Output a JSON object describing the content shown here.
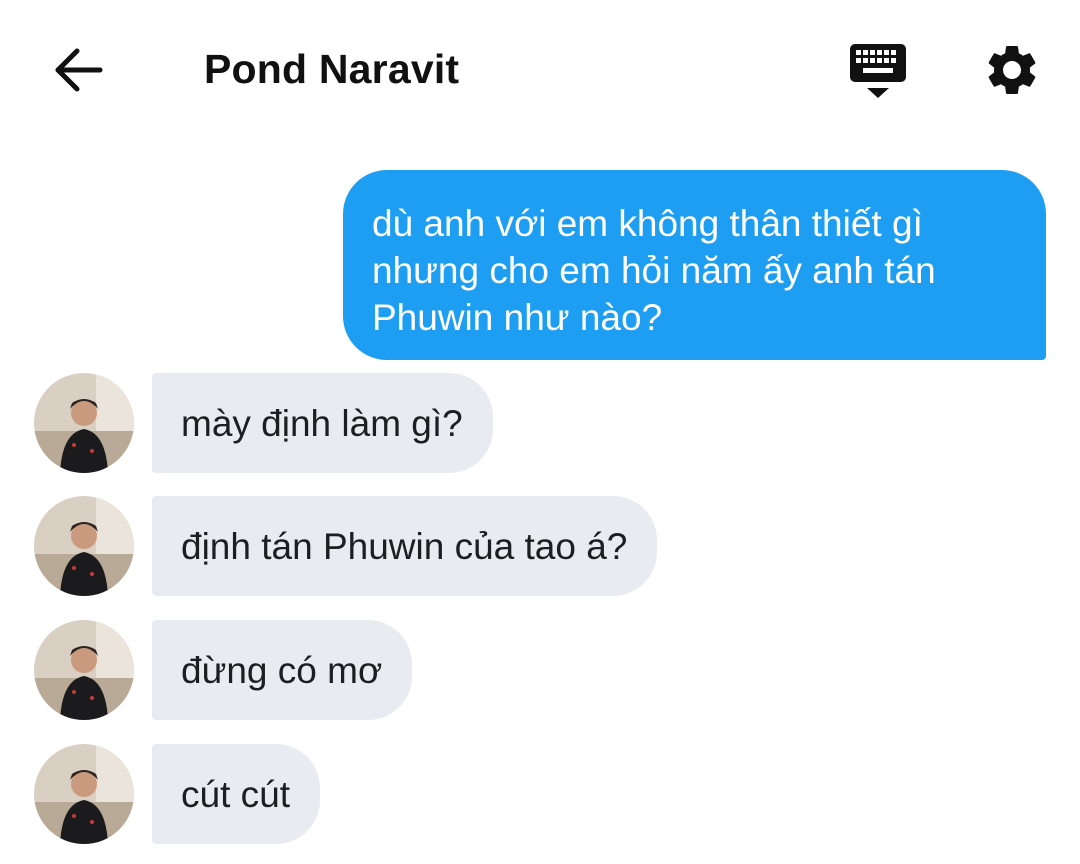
{
  "header": {
    "title": "Pond Naravit",
    "back_icon": "arrow-left-icon",
    "keyboard_icon": "keyboard-hide-icon",
    "settings_icon": "gear-icon"
  },
  "messages": [
    {
      "direction": "outgoing",
      "text": "dù anh với em không thân thiết gì nhưng cho em hỏi năm ấy anh tán Phuwin như nào?"
    },
    {
      "direction": "incoming",
      "text": "mày định làm gì?"
    },
    {
      "direction": "incoming",
      "text": "định tán Phuwin của tao á?"
    },
    {
      "direction": "incoming",
      "text": "đừng có mơ"
    },
    {
      "direction": "incoming",
      "text": "cút cút"
    }
  ],
  "colors": {
    "outgoing_bubble": "#1e9ef2",
    "incoming_bubble": "#e8ebf0",
    "text_dark": "#1c1e21"
  }
}
